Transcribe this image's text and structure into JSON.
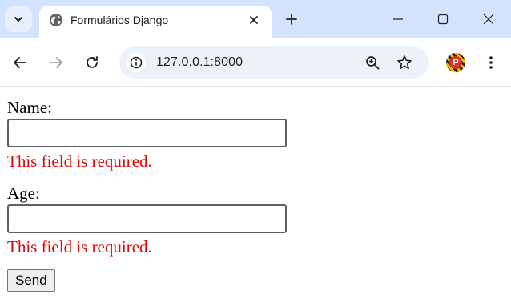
{
  "browser": {
    "tab_title": "Formulários Django",
    "url": "127.0.0.1:8000",
    "profile_initial": "P"
  },
  "form": {
    "fields": [
      {
        "label": "Name:",
        "value": "",
        "error": "This field is required."
      },
      {
        "label": "Age:",
        "value": "",
        "error": "This field is required."
      }
    ],
    "submit_label": "Send",
    "error_color": "#ee0000"
  },
  "colors": {
    "tabbar_bg": "#d3e3fd",
    "omnibox_bg": "#edf2fa"
  }
}
